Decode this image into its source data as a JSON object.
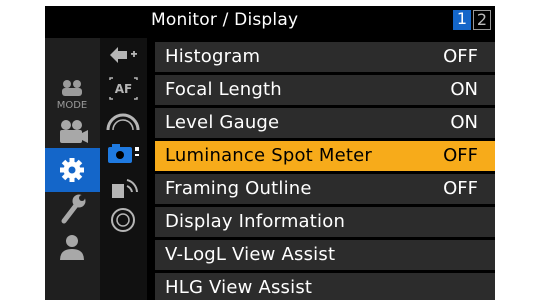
{
  "header": {
    "title": "Monitor / Display",
    "pages": [
      "1",
      "2"
    ],
    "active_page": "1"
  },
  "colors": {
    "accent_blue": "#1466c9",
    "highlight_orange": "#f7ab1a",
    "row_background": "#2c2c2c"
  },
  "sidebar": {
    "categories": [
      {
        "icon": "mode-icon",
        "label": "MODE"
      },
      {
        "icon": "movie-camera-icon",
        "label": ""
      },
      {
        "icon": "gear-icon",
        "label": "",
        "active": true
      },
      {
        "icon": "wrench-icon",
        "label": ""
      },
      {
        "icon": "person-icon",
        "label": ""
      }
    ],
    "subtabs": [
      {
        "icon": "arrow-plus-icon",
        "label": ""
      },
      {
        "icon": "af-icon",
        "label": "AF"
      },
      {
        "icon": "meter-icon",
        "label": ""
      },
      {
        "icon": "monitor-display-icon",
        "label": "",
        "active": true
      },
      {
        "icon": "signal-icon",
        "label": ""
      },
      {
        "icon": "lens-icon",
        "label": ""
      }
    ]
  },
  "menu": {
    "items": [
      {
        "label": "Histogram",
        "value": "OFF"
      },
      {
        "label": "Focal Length",
        "value": "ON"
      },
      {
        "label": "Level Gauge",
        "value": "ON"
      },
      {
        "label": "Luminance Spot Meter",
        "value": "OFF",
        "selected": true
      },
      {
        "label": "Framing Outline",
        "value": "OFF"
      },
      {
        "label": "Display Information",
        "value": ""
      },
      {
        "label": "V-LogL View Assist",
        "value": ""
      },
      {
        "label": "HLG View Assist",
        "value": ""
      }
    ]
  }
}
